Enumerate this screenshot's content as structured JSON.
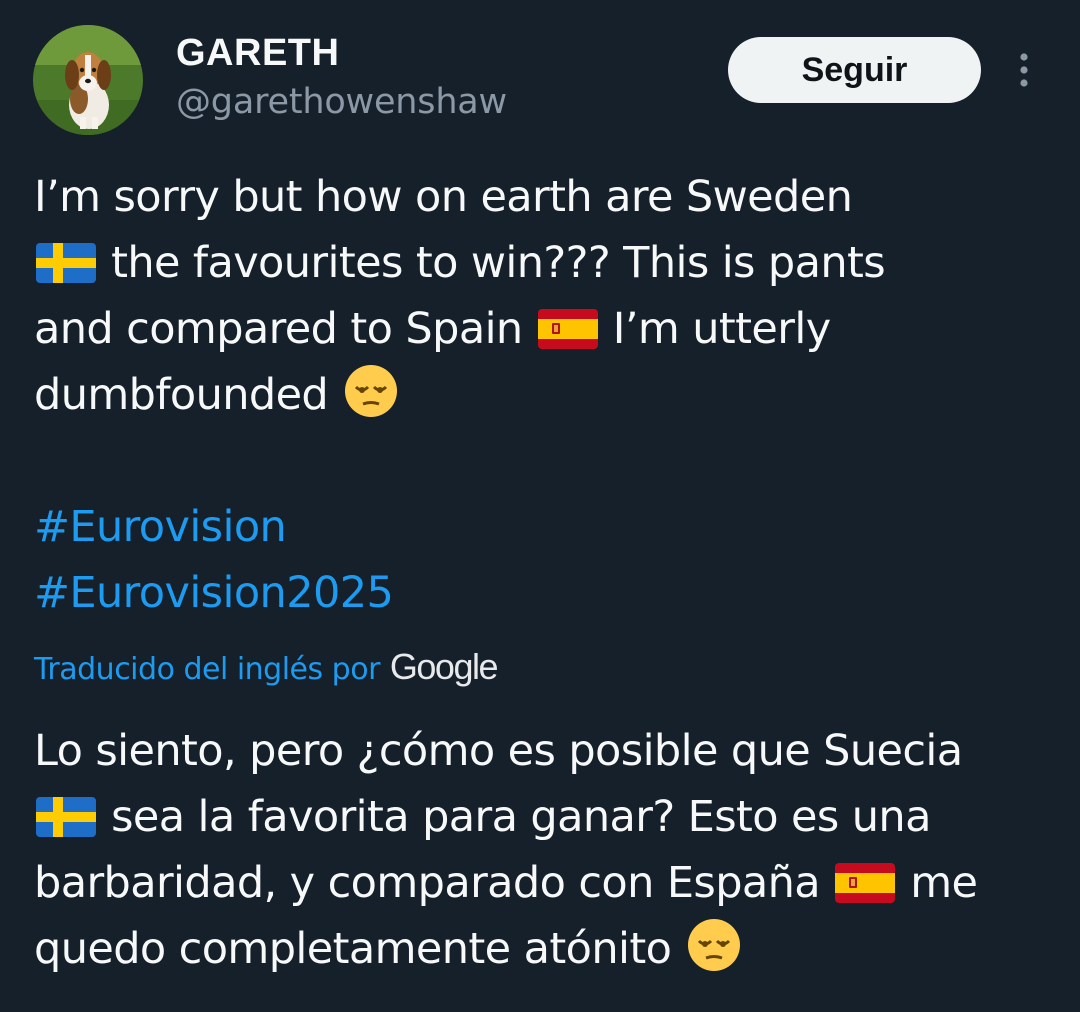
{
  "author": {
    "display_name": "GARETH",
    "handle": "@garethowenshaw"
  },
  "header": {
    "follow_label": "Seguir"
  },
  "tweet": {
    "lines": [
      "I’m sorry but how on earth are Sweden",
      "the favourites to win??? This is pants",
      "and compared to Spain",
      "I’m utterly",
      "dumbfounded"
    ],
    "hashtags": [
      "#Eurovision",
      "#Eurovision2025"
    ]
  },
  "translation": {
    "label": "Traducido del inglés por",
    "provider": "Google",
    "lines": [
      "Lo siento, pero ¿cómo es posible que Suecia",
      "sea la favorita para ganar? Esto es una",
      "barbaridad, y comparado con España",
      "me",
      "quedo completamente atónito"
    ]
  },
  "colors": {
    "background": "#15202b",
    "text": "#f7f9f9",
    "secondary_text": "#8b98a5",
    "link": "#1d9bf0",
    "button_bg": "#eff3f4"
  },
  "icons": {
    "more": "more-vertical-icon",
    "sweden_flag": "sweden-flag-icon",
    "spain_flag": "spain-flag-icon",
    "emoji": "relieved-face-emoji-icon"
  }
}
